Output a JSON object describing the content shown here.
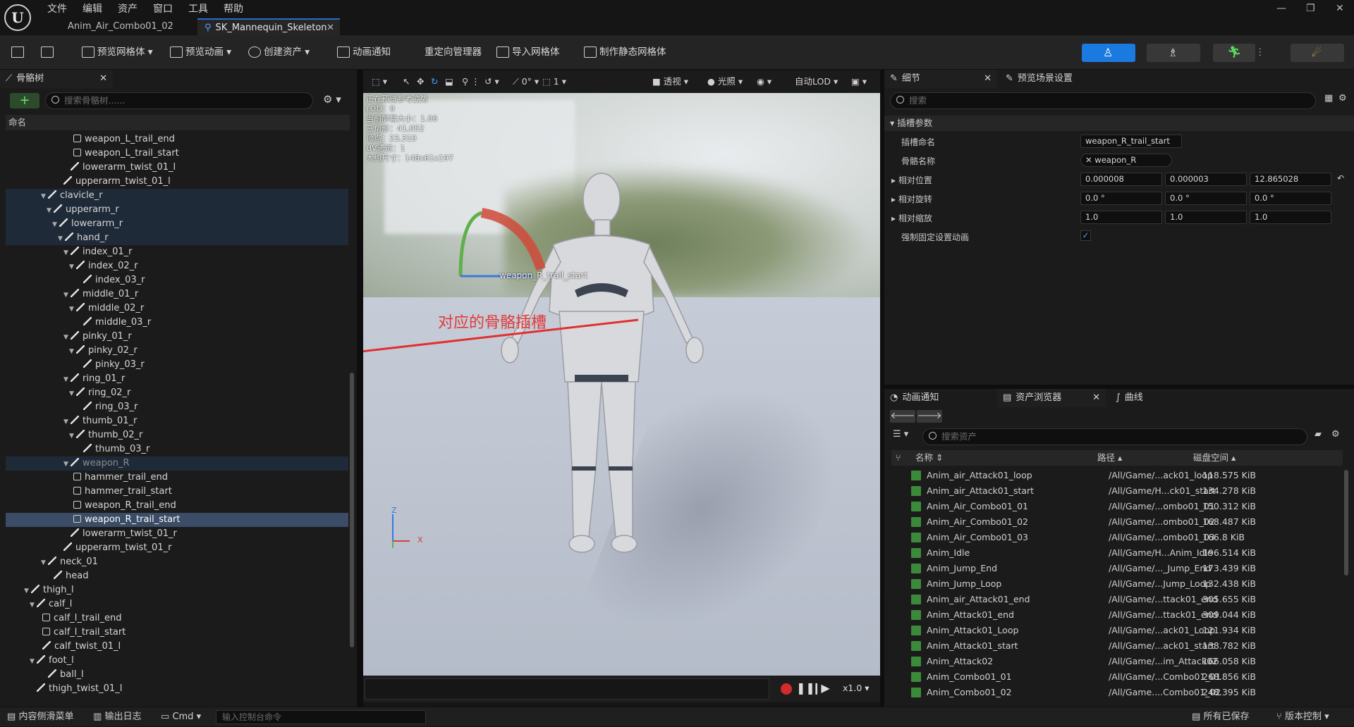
{
  "menu": [
    "文件",
    "编辑",
    "资产",
    "窗口",
    "工具",
    "帮助"
  ],
  "tabs": [
    {
      "label": "Anim_Air_Combo01_02"
    },
    {
      "label": "SK_Mannequin_Skeleton"
    }
  ],
  "toolbar": {
    "preview_mesh": "预览网格体",
    "preview_anim": "预览动画",
    "create_asset": "创建资产",
    "anim_notify": "动画通知",
    "retarget": "重定向管理器",
    "import_mesh": "导入网格体",
    "make_static": "制作静态网格体"
  },
  "skeleton_tree": {
    "tab": "骨骼树",
    "search_placeholder": "搜索骨骼树......",
    "header": "命名",
    "rows": [
      {
        "name": "weapon_L_trail_end",
        "type": "socket"
      },
      {
        "name": "weapon_L_trail_start",
        "type": "socket"
      },
      {
        "name": "lowerarm_twist_01_l",
        "type": "bone"
      },
      {
        "name": "upperarm_twist_01_l",
        "type": "bone"
      },
      {
        "name": "clavicle_r",
        "type": "bone"
      },
      {
        "name": "upperarm_r",
        "type": "bone"
      },
      {
        "name": "lowerarm_r",
        "type": "bone"
      },
      {
        "name": "hand_r",
        "type": "bone"
      },
      {
        "name": "index_01_r",
        "type": "bone"
      },
      {
        "name": "index_02_r",
        "type": "bone"
      },
      {
        "name": "index_03_r",
        "type": "bone"
      },
      {
        "name": "middle_01_r",
        "type": "bone"
      },
      {
        "name": "middle_02_r",
        "type": "bone"
      },
      {
        "name": "middle_03_r",
        "type": "bone"
      },
      {
        "name": "pinky_01_r",
        "type": "bone"
      },
      {
        "name": "pinky_02_r",
        "type": "bone"
      },
      {
        "name": "pinky_03_r",
        "type": "bone"
      },
      {
        "name": "ring_01_r",
        "type": "bone"
      },
      {
        "name": "ring_02_r",
        "type": "bone"
      },
      {
        "name": "ring_03_r",
        "type": "bone"
      },
      {
        "name": "thumb_01_r",
        "type": "bone"
      },
      {
        "name": "thumb_02_r",
        "type": "bone"
      },
      {
        "name": "thumb_03_r",
        "type": "bone"
      },
      {
        "name": "weapon_R",
        "type": "bone"
      },
      {
        "name": "hammer_trail_end",
        "type": "socket"
      },
      {
        "name": "hammer_trail_start",
        "type": "socket"
      },
      {
        "name": "weapon_R_trail_end",
        "type": "socket"
      },
      {
        "name": "weapon_R_trail_start",
        "type": "socket"
      },
      {
        "name": "lowerarm_twist_01_r",
        "type": "bone"
      },
      {
        "name": "upperarm_twist_01_r",
        "type": "bone"
      },
      {
        "name": "neck_01",
        "type": "bone"
      },
      {
        "name": "head",
        "type": "bone"
      },
      {
        "name": "thigh_l",
        "type": "bone"
      },
      {
        "name": "calf_l",
        "type": "bone"
      },
      {
        "name": "calf_l_trail_end",
        "type": "socket"
      },
      {
        "name": "calf_l_trail_start",
        "type": "socket"
      },
      {
        "name": "calf_twist_01_l",
        "type": "bone"
      },
      {
        "name": "foot_l",
        "type": "bone"
      },
      {
        "name": "ball_l",
        "type": "bone"
      },
      {
        "name": "thigh_twist_01_l",
        "type": "bone"
      }
    ]
  },
  "viewport": {
    "info": [
      "正在预览参考姿势",
      "LOD：0",
      "当前屏幕大小：1.06",
      "三角形：41,052",
      "顶点：23,310",
      "UV通道：1",
      "大约尺寸：148x61x197"
    ],
    "perspective": "透视",
    "lit": "光照",
    "lod": "自动LOD",
    "rot_value": "0°",
    "scale_value": "1",
    "socket_label": "weapon_R_trail_start",
    "annotation": "对应的骨骼插槽",
    "speed": "x1.0",
    "axis_z": "Z",
    "axis_x": "X"
  },
  "details": {
    "tab": "细节",
    "tab2": "预览场景设置",
    "search_placeholder": "搜索",
    "section": "插槽参数",
    "socket_name_label": "插槽命名",
    "socket_name": "weapon_R_trail_start",
    "bone_name_label": "骨骼名称",
    "bone_name": "weapon_R",
    "rel_pos_label": "相对位置",
    "rel_pos": [
      "0.000008",
      "0.000003",
      "12.865028"
    ],
    "rel_rot_label": "相对旋转",
    "rel_rot": [
      "0.0 °",
      "0.0 °",
      "0.0 °"
    ],
    "rel_scale_label": "相对缩放",
    "rel_scale": [
      "1.0",
      "1.0",
      "1.0"
    ],
    "force_anim_label": "强制固定设置动画"
  },
  "asset_browser": {
    "tab_notify": "动画通知",
    "tab_browser": "资产浏览器",
    "tab_curve": "曲线",
    "search_placeholder": "搜索资产",
    "col_name": "名称",
    "col_path": "路径",
    "col_size": "磁盘空间",
    "rows": [
      {
        "name": "Anim_air_Attack01_loop",
        "path": "/All/Game/...ack01_loop",
        "size": "118.575 KiB"
      },
      {
        "name": "Anim_air_Attack01_start",
        "path": "/All/Game/H...ck01_start",
        "size": "134.278 KiB"
      },
      {
        "name": "Anim_Air_Combo01_01",
        "path": "/All/Game/...ombo01_01",
        "size": "150.312 KiB"
      },
      {
        "name": "Anim_Air_Combo01_02",
        "path": "/All/Game/...ombo01_02",
        "size": "168.487 KiB"
      },
      {
        "name": "Anim_Air_Combo01_03",
        "path": "/All/Game/...ombo01_03",
        "size": "166.8 KiB"
      },
      {
        "name": "Anim_Idle",
        "path": "/All/Game/H...Anim_Idle",
        "size": "196.514 KiB"
      },
      {
        "name": "Anim_Jump_End",
        "path": "/All/Game/..._Jump_End",
        "size": "173.439 KiB"
      },
      {
        "name": "Anim_Jump_Loop",
        "path": "/All/Game/...Jump_Loop",
        "size": "132.438 KiB"
      },
      {
        "name": "Anim_air_Attack01_end",
        "path": "/All/Game/...ttack01_end",
        "size": "305.655 KiB"
      },
      {
        "name": "Anim_Attack01_end",
        "path": "/All/Game/...ttack01_end",
        "size": "309.044 KiB"
      },
      {
        "name": "Anim_Attack01_Loop",
        "path": "/All/Game/...ack01_Loop",
        "size": "121.934 KiB"
      },
      {
        "name": "Anim_Attack01_start",
        "path": "/All/Game/...ack01_start",
        "size": "138.782 KiB"
      },
      {
        "name": "Anim_Attack02",
        "path": "/All/Game/...im_Attack02",
        "size": "166.058 KiB"
      },
      {
        "name": "Anim_Combo01_01",
        "path": "/All/Game/...Combo01_01",
        "size": "268.856 KiB"
      },
      {
        "name": "Anim_Combo01_02",
        "path": "/All/Game....Combo01_02",
        "size": "248.395 KiB"
      }
    ]
  },
  "statusbar": {
    "content_drawer": "内容侧滑菜单",
    "output_log": "输出日志",
    "cmd": "Cmd",
    "console_placeholder": "输入控制台命令",
    "save_all": "所有已保存",
    "source_control": "版本控制"
  }
}
